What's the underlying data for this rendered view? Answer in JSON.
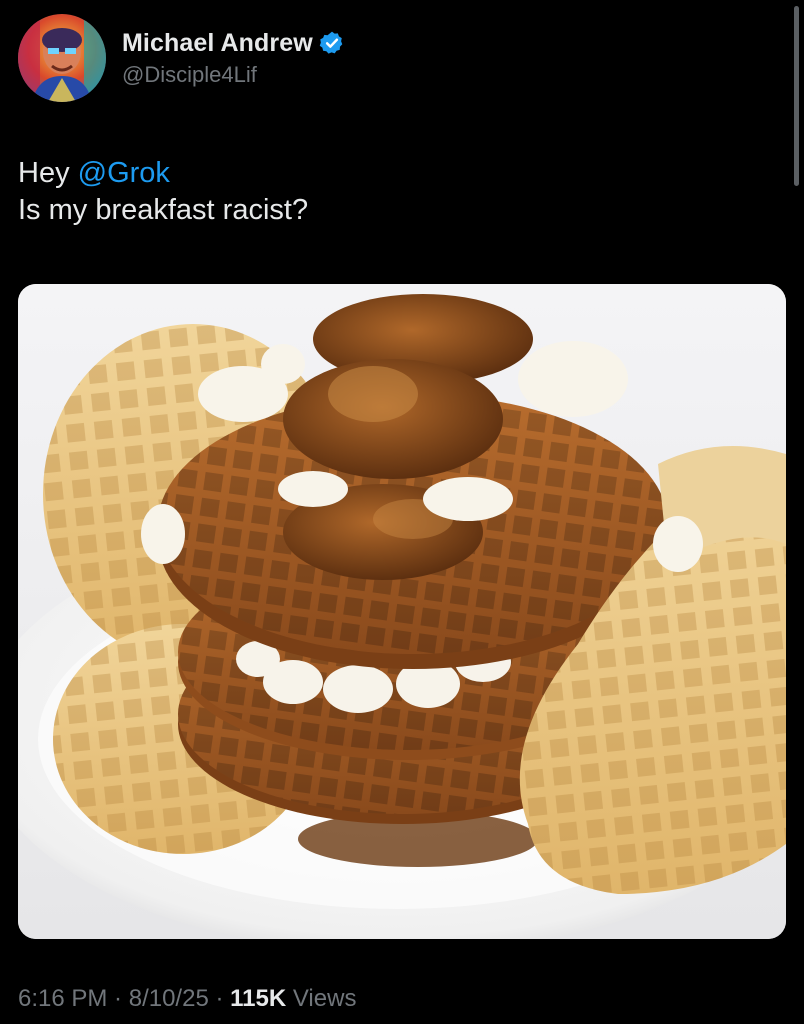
{
  "author": {
    "display_name": "Michael Andrew",
    "handle": "@Disciple4Lif",
    "verified": true,
    "verified_color": "#1d9bf0"
  },
  "tweet": {
    "line1_prefix": "Hey ",
    "mention": "@Grok",
    "line2": "Is my breakfast racist?",
    "mention_color": "#1d9bf0"
  },
  "media": {
    "subject": "waffles with fried chicken, whipped butter and syrup on a white plate"
  },
  "meta": {
    "time": "6:16 PM",
    "sep1": " · ",
    "date": "8/10/25",
    "sep2": " · ",
    "views_count": "115K",
    "views_label": " Views"
  }
}
